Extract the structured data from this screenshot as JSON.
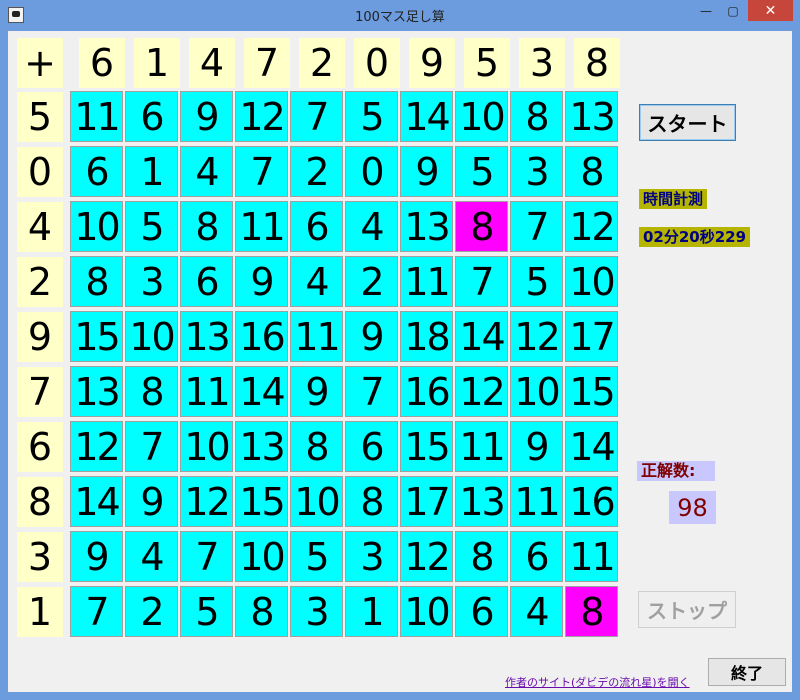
{
  "window": {
    "title": "100マス足し算",
    "close_glyph": "✕",
    "min_glyph": "—",
    "max_glyph": "▢"
  },
  "grid": {
    "corner": "+",
    "col_headers": [
      "6",
      "1",
      "4",
      "7",
      "2",
      "0",
      "9",
      "5",
      "3",
      "8"
    ],
    "row_headers": [
      "5",
      "0",
      "4",
      "2",
      "9",
      "7",
      "6",
      "8",
      "3",
      "1"
    ],
    "cells": [
      [
        "11",
        "6",
        "9",
        "12",
        "7",
        "5",
        "14",
        "10",
        "8",
        "13"
      ],
      [
        "6",
        "1",
        "4",
        "7",
        "2",
        "0",
        "9",
        "5",
        "3",
        "8"
      ],
      [
        "10",
        "5",
        "8",
        "11",
        "6",
        "4",
        "13",
        "8",
        "7",
        "12"
      ],
      [
        "8",
        "3",
        "6",
        "9",
        "4",
        "2",
        "11",
        "7",
        "5",
        "10"
      ],
      [
        "15",
        "10",
        "13",
        "16",
        "11",
        "9",
        "18",
        "14",
        "12",
        "17"
      ],
      [
        "13",
        "8",
        "11",
        "14",
        "9",
        "7",
        "16",
        "12",
        "10",
        "15"
      ],
      [
        "12",
        "7",
        "10",
        "13",
        "8",
        "6",
        "15",
        "11",
        "9",
        "14"
      ],
      [
        "14",
        "9",
        "12",
        "15",
        "10",
        "8",
        "17",
        "13",
        "11",
        "16"
      ],
      [
        "9",
        "4",
        "7",
        "10",
        "5",
        "3",
        "12",
        "8",
        "6",
        "11"
      ],
      [
        "7",
        "2",
        "5",
        "8",
        "3",
        "1",
        "10",
        "6",
        "4",
        "8"
      ]
    ],
    "highlighted": [
      [
        2,
        7
      ],
      [
        9,
        9
      ]
    ],
    "colors": {
      "cell": "#00ffff",
      "highlight": "#ff00ff",
      "header": "#ffffc8"
    }
  },
  "controls": {
    "start": "スタート",
    "stop": "ストップ",
    "exit": "終了",
    "timer_label": "時間計測",
    "timer_value": "02分20秒229",
    "score_label": "正解数:",
    "score_value": "98",
    "link": "作者のサイト(ダビデの流れ星)を開く"
  }
}
